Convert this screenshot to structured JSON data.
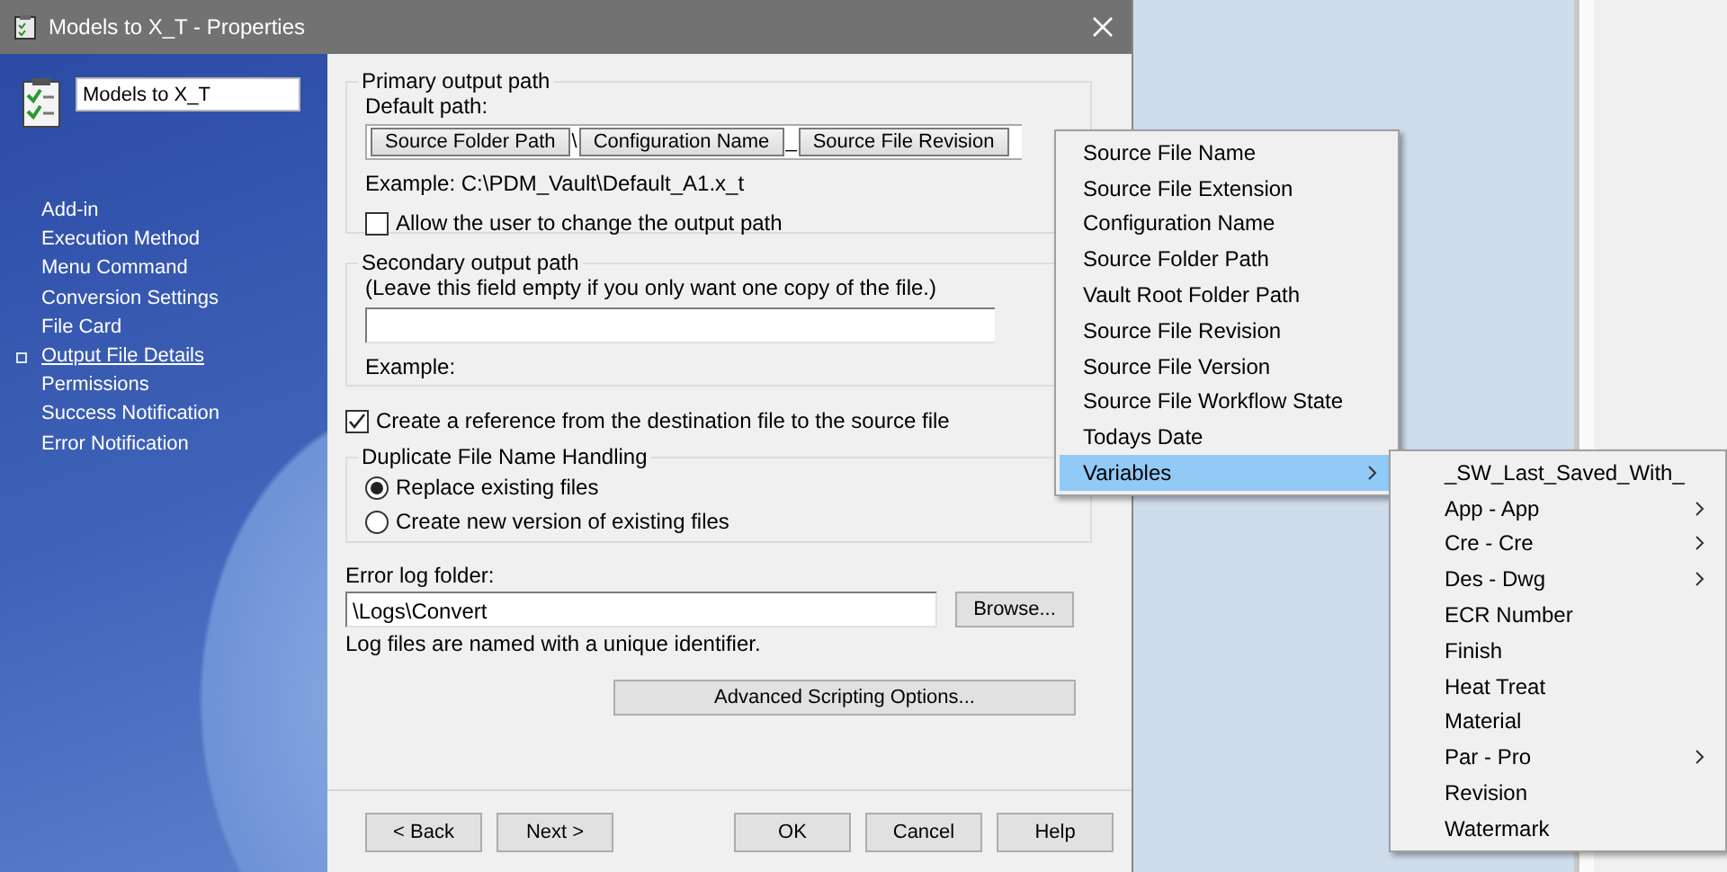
{
  "window": {
    "title": "Models to X_T - Properties"
  },
  "sidebar": {
    "name_field": "Models to X_T",
    "items": [
      {
        "label": "Add-in",
        "selected": false
      },
      {
        "label": "Execution Method",
        "selected": false
      },
      {
        "label": "Menu Command",
        "selected": false
      },
      {
        "label": "Conversion Settings",
        "selected": false
      },
      {
        "label": "File Card",
        "selected": false
      },
      {
        "label": "Output File Details",
        "selected": true
      },
      {
        "label": "Permissions",
        "selected": false
      },
      {
        "label": "Success Notification",
        "selected": false
      },
      {
        "label": "Error Notification",
        "selected": false
      }
    ]
  },
  "primary_output": {
    "legend": "Primary output path",
    "default_label": "Default path:",
    "path_tokens": [
      {
        "kind": "variable",
        "label": "Source Folder Path"
      },
      {
        "kind": "text",
        "label": "\\"
      },
      {
        "kind": "variable",
        "label": "Configuration Name"
      },
      {
        "kind": "text",
        "label": "_"
      },
      {
        "kind": "variable",
        "label": "Source File Revision"
      }
    ],
    "example": "Example: C:\\PDM_Vault\\Default_A1.x_t",
    "allow_change": {
      "label": "Allow the user to change the output path",
      "checked": false
    }
  },
  "secondary_output": {
    "legend": "Secondary output path",
    "hint": "(Leave this field empty if you only want one copy of the file.)",
    "example": "Example:"
  },
  "reference": {
    "label": "Create a reference from the destination file to the source file",
    "checked": true
  },
  "duplicate_handling": {
    "legend": "Duplicate File Name Handling",
    "options": [
      {
        "label": "Replace existing files",
        "selected": true
      },
      {
        "label": "Create new version of existing files",
        "selected": false
      }
    ]
  },
  "error_log": {
    "label": "Error log folder:",
    "value": "\\Logs\\Convert",
    "browse": "Browse...",
    "note": "Log files are named with a unique identifier."
  },
  "advanced_button": "Advanced Scripting Options...",
  "footer": {
    "nav_buttons": [
      "< Back",
      "Next >"
    ],
    "dialog_buttons": [
      "OK",
      "Cancel",
      "Help"
    ]
  },
  "context_menu": {
    "items": [
      {
        "label": "Source File Name",
        "has_submenu": false,
        "selected": false
      },
      {
        "label": "Source File Extension",
        "has_submenu": false,
        "selected": false
      },
      {
        "label": "Configuration Name",
        "has_submenu": false,
        "selected": false
      },
      {
        "label": "Source Folder Path",
        "has_submenu": false,
        "selected": false
      },
      {
        "label": "Vault Root Folder Path",
        "has_submenu": false,
        "selected": false
      },
      {
        "label": "Source File Revision",
        "has_submenu": false,
        "selected": false
      },
      {
        "label": "Source File Version",
        "has_submenu": false,
        "selected": false
      },
      {
        "label": "Source File Workflow State",
        "has_submenu": false,
        "selected": false
      },
      {
        "label": "Todays Date",
        "has_submenu": false,
        "selected": false
      },
      {
        "label": "Variables",
        "has_submenu": true,
        "selected": true
      }
    ]
  },
  "submenu": {
    "items": [
      {
        "label": "_SW_Last_Saved_With_",
        "has_submenu": false
      },
      {
        "label": "App - App",
        "has_submenu": true
      },
      {
        "label": "Cre - Cre",
        "has_submenu": true
      },
      {
        "label": "Des - Dwg",
        "has_submenu": true
      },
      {
        "label": "ECR Number",
        "has_submenu": false
      },
      {
        "label": "Finish",
        "has_submenu": false
      },
      {
        "label": "Heat Treat",
        "has_submenu": false
      },
      {
        "label": "Material",
        "has_submenu": false
      },
      {
        "label": "Par - Pro",
        "has_submenu": true
      },
      {
        "label": "Revision",
        "has_submenu": false
      },
      {
        "label": "Watermark",
        "has_submenu": false
      }
    ]
  }
}
